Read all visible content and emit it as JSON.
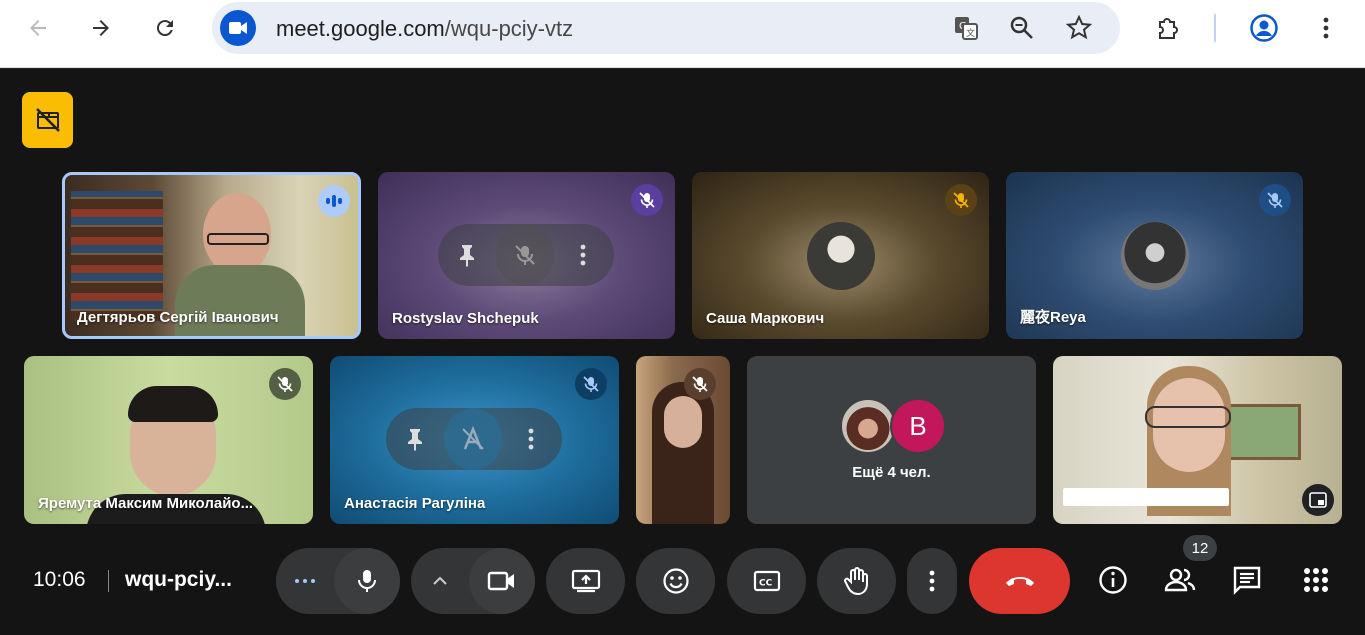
{
  "browser": {
    "url_host": "meet.google.com",
    "url_path": "/wqu-pciy-vtz"
  },
  "tiles": [
    {
      "name": "Дегтярьов Сергій Іванович",
      "state": "speaking"
    },
    {
      "name": "Rostyslav Shchepuk",
      "state": "muted"
    },
    {
      "name": "Саша Маркович",
      "state": "muted"
    },
    {
      "name": "麗夜Reya",
      "state": "muted"
    },
    {
      "name": "Яремута Максим Миколайо...",
      "state": "muted"
    },
    {
      "name": "Анастасія Рагуліна",
      "state": "muted"
    },
    {
      "name": "",
      "state": "muted"
    },
    {
      "name": "Ещё 4 чел.",
      "avatar_letter": "B"
    },
    {
      "name": "",
      "state": "self"
    }
  ],
  "controls": {
    "time": "10:06",
    "meeting_code": "wqu-pciy...",
    "people_count": "12"
  },
  "colors": {
    "hangup": "#dc362e",
    "accent": "#8ab4f8",
    "record_badge": "#fbbc04"
  }
}
